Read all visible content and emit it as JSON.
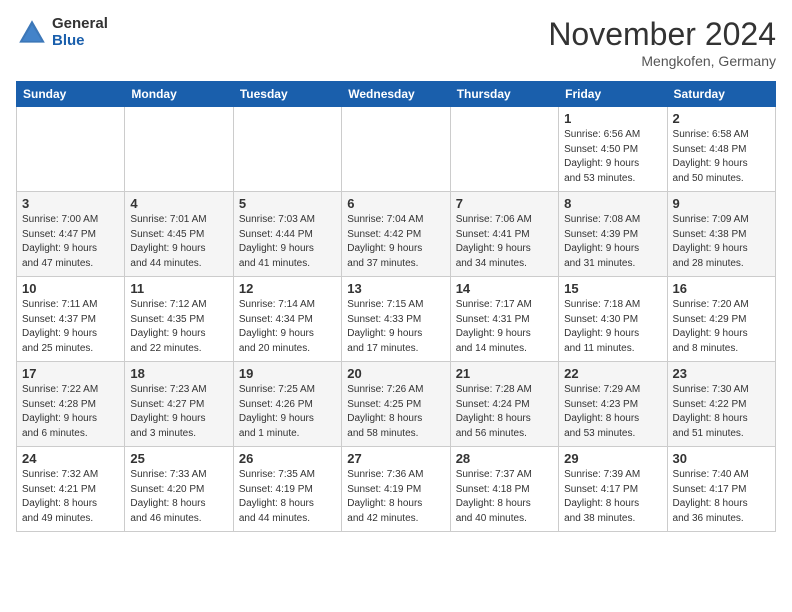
{
  "logo": {
    "general": "General",
    "blue": "Blue"
  },
  "title": "November 2024",
  "location": "Mengkofen, Germany",
  "days_of_week": [
    "Sunday",
    "Monday",
    "Tuesday",
    "Wednesday",
    "Thursday",
    "Friday",
    "Saturday"
  ],
  "weeks": [
    [
      {
        "day": "",
        "info": ""
      },
      {
        "day": "",
        "info": ""
      },
      {
        "day": "",
        "info": ""
      },
      {
        "day": "",
        "info": ""
      },
      {
        "day": "",
        "info": ""
      },
      {
        "day": "1",
        "info": "Sunrise: 6:56 AM\nSunset: 4:50 PM\nDaylight: 9 hours\nand 53 minutes."
      },
      {
        "day": "2",
        "info": "Sunrise: 6:58 AM\nSunset: 4:48 PM\nDaylight: 9 hours\nand 50 minutes."
      }
    ],
    [
      {
        "day": "3",
        "info": "Sunrise: 7:00 AM\nSunset: 4:47 PM\nDaylight: 9 hours\nand 47 minutes."
      },
      {
        "day": "4",
        "info": "Sunrise: 7:01 AM\nSunset: 4:45 PM\nDaylight: 9 hours\nand 44 minutes."
      },
      {
        "day": "5",
        "info": "Sunrise: 7:03 AM\nSunset: 4:44 PM\nDaylight: 9 hours\nand 41 minutes."
      },
      {
        "day": "6",
        "info": "Sunrise: 7:04 AM\nSunset: 4:42 PM\nDaylight: 9 hours\nand 37 minutes."
      },
      {
        "day": "7",
        "info": "Sunrise: 7:06 AM\nSunset: 4:41 PM\nDaylight: 9 hours\nand 34 minutes."
      },
      {
        "day": "8",
        "info": "Sunrise: 7:08 AM\nSunset: 4:39 PM\nDaylight: 9 hours\nand 31 minutes."
      },
      {
        "day": "9",
        "info": "Sunrise: 7:09 AM\nSunset: 4:38 PM\nDaylight: 9 hours\nand 28 minutes."
      }
    ],
    [
      {
        "day": "10",
        "info": "Sunrise: 7:11 AM\nSunset: 4:37 PM\nDaylight: 9 hours\nand 25 minutes."
      },
      {
        "day": "11",
        "info": "Sunrise: 7:12 AM\nSunset: 4:35 PM\nDaylight: 9 hours\nand 22 minutes."
      },
      {
        "day": "12",
        "info": "Sunrise: 7:14 AM\nSunset: 4:34 PM\nDaylight: 9 hours\nand 20 minutes."
      },
      {
        "day": "13",
        "info": "Sunrise: 7:15 AM\nSunset: 4:33 PM\nDaylight: 9 hours\nand 17 minutes."
      },
      {
        "day": "14",
        "info": "Sunrise: 7:17 AM\nSunset: 4:31 PM\nDaylight: 9 hours\nand 14 minutes."
      },
      {
        "day": "15",
        "info": "Sunrise: 7:18 AM\nSunset: 4:30 PM\nDaylight: 9 hours\nand 11 minutes."
      },
      {
        "day": "16",
        "info": "Sunrise: 7:20 AM\nSunset: 4:29 PM\nDaylight: 9 hours\nand 8 minutes."
      }
    ],
    [
      {
        "day": "17",
        "info": "Sunrise: 7:22 AM\nSunset: 4:28 PM\nDaylight: 9 hours\nand 6 minutes."
      },
      {
        "day": "18",
        "info": "Sunrise: 7:23 AM\nSunset: 4:27 PM\nDaylight: 9 hours\nand 3 minutes."
      },
      {
        "day": "19",
        "info": "Sunrise: 7:25 AM\nSunset: 4:26 PM\nDaylight: 9 hours\nand 1 minute."
      },
      {
        "day": "20",
        "info": "Sunrise: 7:26 AM\nSunset: 4:25 PM\nDaylight: 8 hours\nand 58 minutes."
      },
      {
        "day": "21",
        "info": "Sunrise: 7:28 AM\nSunset: 4:24 PM\nDaylight: 8 hours\nand 56 minutes."
      },
      {
        "day": "22",
        "info": "Sunrise: 7:29 AM\nSunset: 4:23 PM\nDaylight: 8 hours\nand 53 minutes."
      },
      {
        "day": "23",
        "info": "Sunrise: 7:30 AM\nSunset: 4:22 PM\nDaylight: 8 hours\nand 51 minutes."
      }
    ],
    [
      {
        "day": "24",
        "info": "Sunrise: 7:32 AM\nSunset: 4:21 PM\nDaylight: 8 hours\nand 49 minutes."
      },
      {
        "day": "25",
        "info": "Sunrise: 7:33 AM\nSunset: 4:20 PM\nDaylight: 8 hours\nand 46 minutes."
      },
      {
        "day": "26",
        "info": "Sunrise: 7:35 AM\nSunset: 4:19 PM\nDaylight: 8 hours\nand 44 minutes."
      },
      {
        "day": "27",
        "info": "Sunrise: 7:36 AM\nSunset: 4:19 PM\nDaylight: 8 hours\nand 42 minutes."
      },
      {
        "day": "28",
        "info": "Sunrise: 7:37 AM\nSunset: 4:18 PM\nDaylight: 8 hours\nand 40 minutes."
      },
      {
        "day": "29",
        "info": "Sunrise: 7:39 AM\nSunset: 4:17 PM\nDaylight: 8 hours\nand 38 minutes."
      },
      {
        "day": "30",
        "info": "Sunrise: 7:40 AM\nSunset: 4:17 PM\nDaylight: 8 hours\nand 36 minutes."
      }
    ]
  ]
}
